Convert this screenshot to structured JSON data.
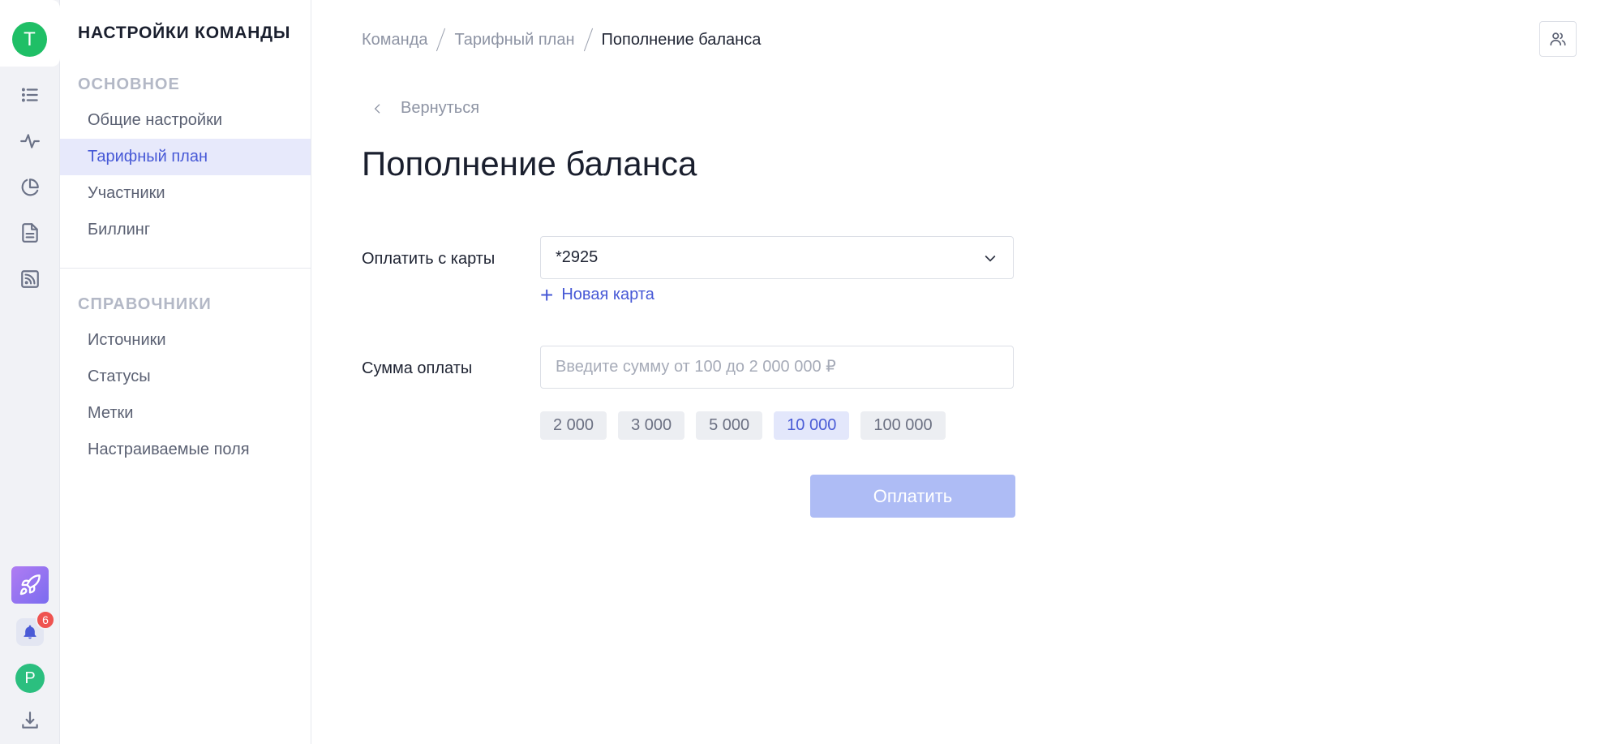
{
  "rail": {
    "team_initial": "T",
    "user_initial": "P",
    "notification_count": "6",
    "icons": [
      "list-icon",
      "activity-icon",
      "pie-chart-icon",
      "document-icon",
      "rss-icon",
      "rocket-icon",
      "bell-icon",
      "download-icon"
    ]
  },
  "sidebar": {
    "title": "Настройки команды",
    "sections": [
      {
        "label": "Основное",
        "items": [
          {
            "label": "Общие настройки",
            "active": false
          },
          {
            "label": "Тарифный план",
            "active": true
          },
          {
            "label": "Участники",
            "active": false
          },
          {
            "label": "Биллинг",
            "active": false
          }
        ]
      },
      {
        "label": "Справочники",
        "items": [
          {
            "label": "Источники",
            "active": false
          },
          {
            "label": "Статусы",
            "active": false
          },
          {
            "label": "Метки",
            "active": false
          },
          {
            "label": "Настраиваемые поля",
            "active": false
          }
        ]
      }
    ]
  },
  "breadcrumb": [
    "Команда",
    "Тарифный план",
    "Пополнение баланса"
  ],
  "back_label": "Вернуться",
  "page_title": "Пополнение баланса",
  "form": {
    "card_label": "Оплатить с карты",
    "card_value": "*2925",
    "new_card_label": "Новая карта",
    "amount_label": "Сумма оплаты",
    "amount_value": "",
    "amount_placeholder": "Введите сумму от 100 до 2 000 000 ₽",
    "presets": [
      "2 000",
      "3 000",
      "5 000",
      "10 000",
      "100 000"
    ],
    "active_preset": "10 000",
    "pay_label": "Оплатить"
  },
  "colors": {
    "accent": "#4658d6",
    "active_nav_bg": "#e7e9fb",
    "pay_button_disabled": "#aebcf5",
    "team_avatar": "#1fbf66",
    "badge": "#ef5350"
  }
}
